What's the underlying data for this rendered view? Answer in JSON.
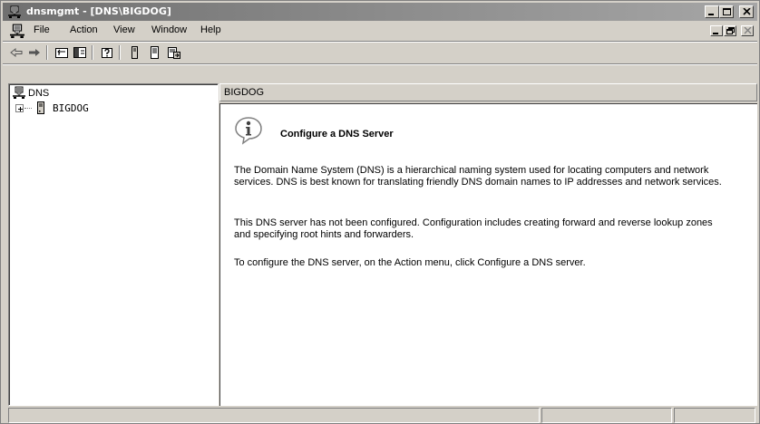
{
  "window": {
    "title": "dnsmgmt - [DNS\\BIGDOG]"
  },
  "menu": {
    "file": "File",
    "action": "Action",
    "view": "View",
    "window": "Window",
    "help": "Help"
  },
  "tree": {
    "root_label": "DNS",
    "child_label": "BIGDOG"
  },
  "right_pane": {
    "header": "BIGDOG",
    "title": "Configure a DNS Server",
    "paragraphs": [
      "The Domain Name System (DNS) is a hierarchical naming system used for locating computers and network services. DNS is best known for translating friendly DNS domain names to IP addresses and network services.",
      "This DNS server has not been configured. Configuration includes creating forward and reverse lookup zones and specifying root hints and forwarders.",
      "To configure the DNS server, on the Action menu, click Configure a DNS server."
    ]
  },
  "icons": {
    "app": "dns-computer-icon",
    "back": "back-arrow-icon",
    "forward": "forward-arrow-icon",
    "up": "up-one-level-icon",
    "show_hide_tree": "show-hide-tree-icon",
    "help": "help-icon",
    "server_properties": "server-properties-icon",
    "server_list": "server-list-icon",
    "export": "export-list-icon",
    "info": "information-icon"
  },
  "colors": {
    "title_bar_start": "#707070",
    "title_bar_end": "#a6a6a6",
    "chrome": "#d4d0c8",
    "content_bg": "#ffffff"
  }
}
